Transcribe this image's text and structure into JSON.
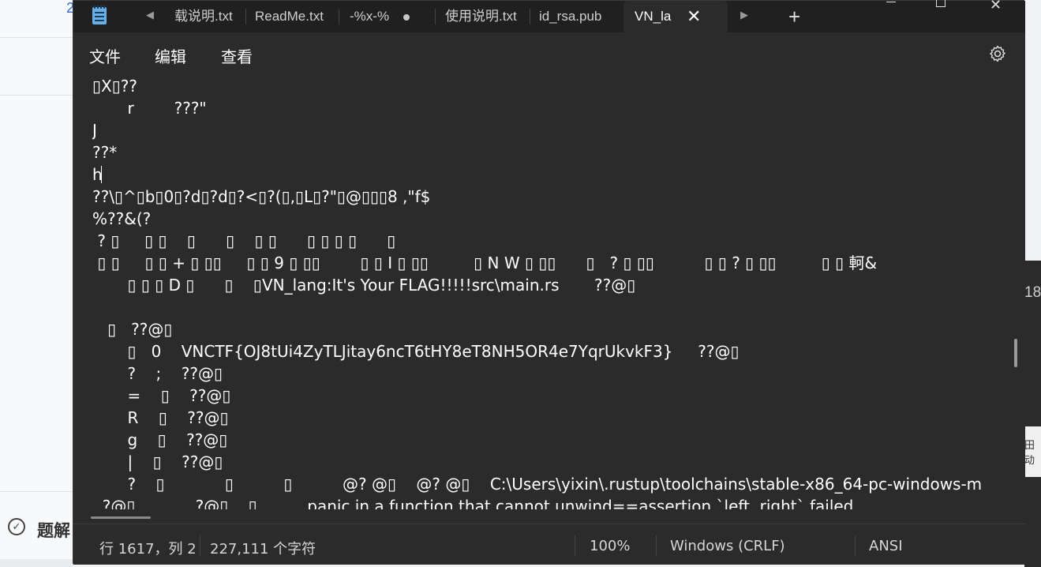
{
  "tabs": [
    {
      "label": "载说明.txt",
      "modified": false,
      "active": false
    },
    {
      "label": "ReadMe.txt",
      "modified": false,
      "active": false
    },
    {
      "label": "-%x-%",
      "modified": true,
      "active": false
    },
    {
      "label": "使用说明.txt",
      "modified": false,
      "active": false
    },
    {
      "label": "id_rsa.pub",
      "modified": false,
      "active": false
    },
    {
      "label": "VN_la",
      "modified": false,
      "active": true
    }
  ],
  "tab_icons": {
    "scroll_left": "triangle-left-icon",
    "scroll_right": "triangle-right-icon",
    "close": "close-icon",
    "new_tab": "plus-icon"
  },
  "menu": {
    "file": "文件",
    "edit": "编辑",
    "view": "查看"
  },
  "window_controls": [
    "minimize-icon",
    "maximize-icon",
    "close-icon"
  ],
  "editor": {
    "lines": [
      "▯X▯??",
      "       r        ???\"",
      "J",
      "??*",
      "h",
      "??\\▯^▯b▯0▯?d▯?d▯?<▯?(▯,▯L▯?\"▯@▯▯▯8 ,\"f$",
      "%??&(?",
      " ? ▯     ▯ ▯    ▯      ▯    ▯ ▯      ▯ ▯ ▯ ▯      ▯",
      " ▯ ▯     ▯ ▯ + ▯ ▯▯     ▯ ▯ 9 ▯ ▯▯        ▯ ▯ I ▯ ▯▯         ▯ N W ▯ ▯▯      ▯   ? ▯ ▯▯          ▯ ▯ ? ▯ ▯▯         ▯ ▯ 軻&",
      "       ▯ ▯ ▯ D ▯      ▯    ▯VN_lang:It's Your FLAG!!!!!src\\main.rs       ??@▯",
      "",
      "   ▯   ??@▯",
      "       ▯   0    VNCTF{OJ8tUi4ZyTLJitay6ncT6tHY8eT8NH5OR4e7YqrUkvkF3}     ??@▯",
      "       ?    ;    ??@▯",
      "       =    ▯    ??@▯",
      "       R    ▯    ??@▯",
      "       g    ▯    ??@▯",
      "       |    ▯    ??@▯",
      "       ?    ▯            ▯          ▯          @? @▯    @? @▯    C:\\Users\\yixin\\.rustup\\toolchains\\stable-x86_64-pc-windows-m",
      "  ?@▯            ?@▯    ▯          panic in a function that cannot unwind==assertion `left  right` failed"
    ]
  },
  "status": {
    "position": "行 1617，列 2",
    "chars": "227,111 个字符",
    "zoom": "100%",
    "line_ending": "Windows (CRLF)",
    "encoding": "ANSI"
  },
  "background": {
    "left_number": "2",
    "left_label": "题解",
    "right_number": "18",
    "right_label": "田动"
  }
}
